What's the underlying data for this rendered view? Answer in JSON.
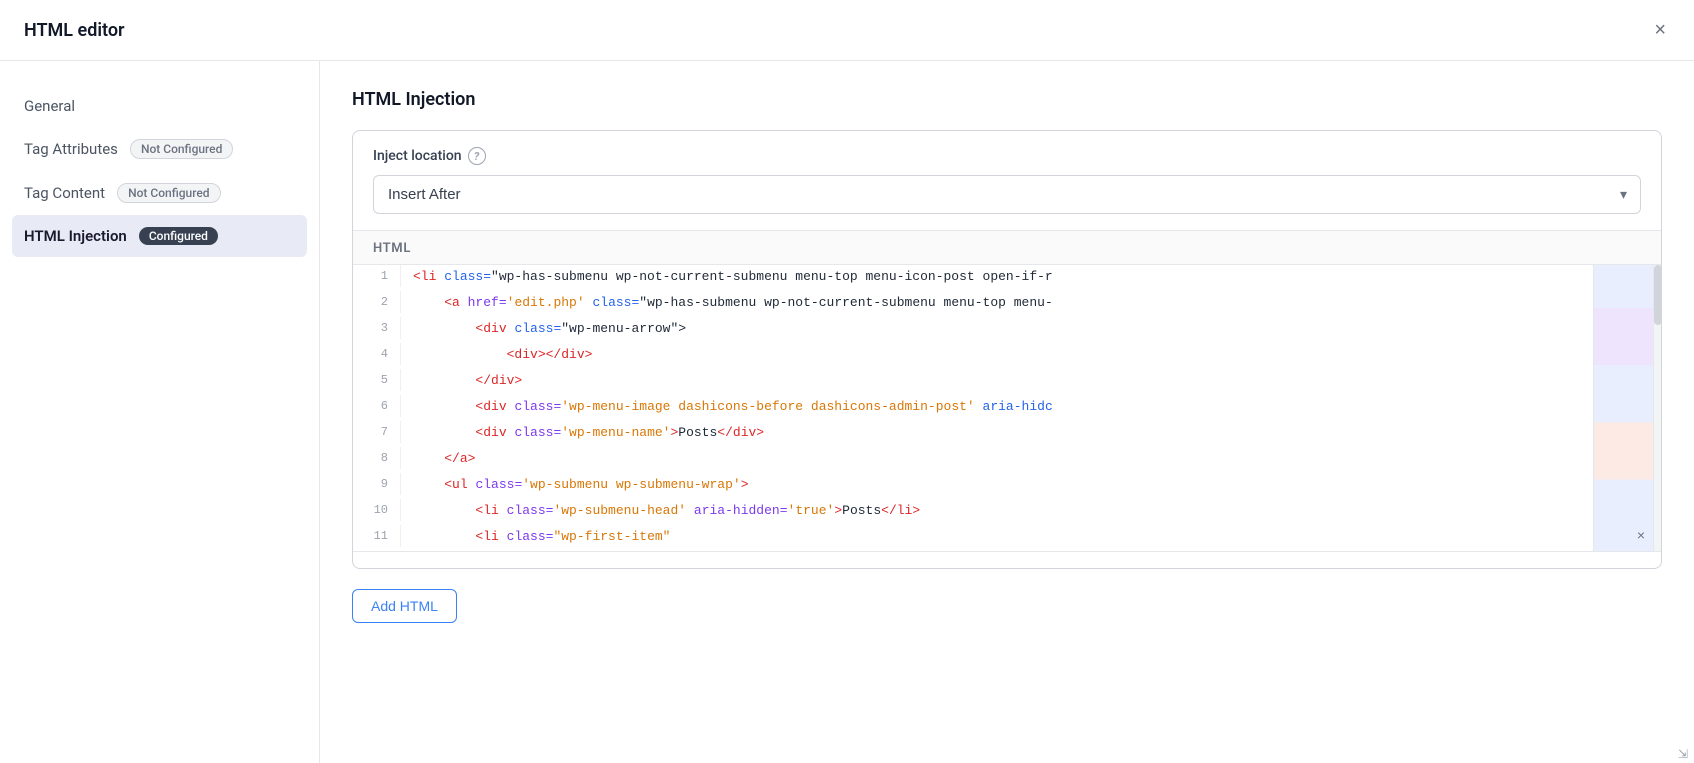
{
  "modal": {
    "title": "HTML editor",
    "close_label": "×"
  },
  "sidebar": {
    "items": [
      {
        "id": "general",
        "label": "General",
        "badge": null,
        "active": false
      },
      {
        "id": "tag-attributes",
        "label": "Tag Attributes",
        "badge": "Not Configured",
        "badge_type": "not-configured",
        "active": false
      },
      {
        "id": "tag-content",
        "label": "Tag Content",
        "badge": "Not Configured",
        "badge_type": "not-configured",
        "active": false
      },
      {
        "id": "html-injection",
        "label": "HTML Injection",
        "badge": "Configured",
        "badge_type": "configured",
        "active": true
      }
    ]
  },
  "main": {
    "section_title": "HTML Injection",
    "inject_location_label": "Inject location",
    "inject_location_value": "Insert After",
    "html_label": "HTML",
    "add_html_btn": "Add HTML",
    "code_lines": [
      {
        "num": 1,
        "content": "<li class=\"wp-has-submenu wp-not-current-submenu menu-top menu-icon-post open-if-r"
      },
      {
        "num": 2,
        "content": "    <a href='edit.php' class=\"wp-has-submenu wp-not-current-submenu menu-top menu-"
      },
      {
        "num": 3,
        "content": "        <div class=\"wp-menu-arrow\">"
      },
      {
        "num": 4,
        "content": "            <div></div>"
      },
      {
        "num": 5,
        "content": "        </div>"
      },
      {
        "num": 6,
        "content": "        <div class='wp-menu-image dashicons-before dashicons-admin-post' aria-hidc"
      },
      {
        "num": 7,
        "content": "        <div class='wp-menu-name'>Posts</div>"
      },
      {
        "num": 8,
        "content": "    </a>"
      },
      {
        "num": 9,
        "content": "    <ul class='wp-submenu wp-submenu-wrap'>"
      },
      {
        "num": 10,
        "content": "        <li class='wp-submenu-head' aria-hidden='true'>Posts</li>"
      },
      {
        "num": 11,
        "content": "        <li class=\"wp-first-item\">"
      }
    ]
  }
}
